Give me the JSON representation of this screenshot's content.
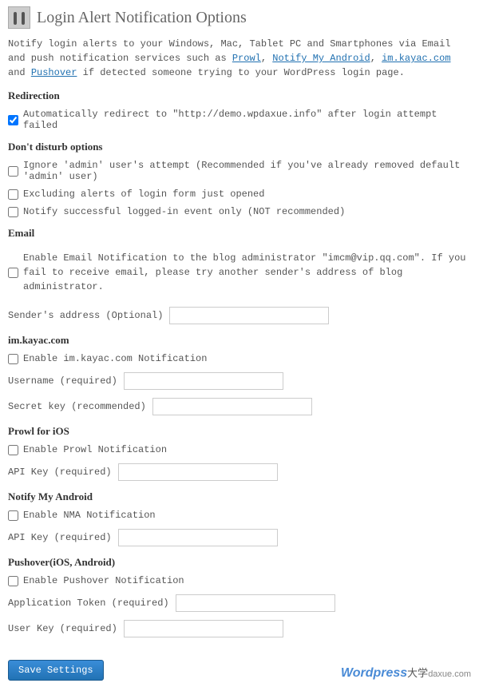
{
  "page": {
    "title": "Login Alert Notification Options",
    "intro_pre": "Notify login alerts to your Windows, Mac, Tablet PC and Smartphones via Email and push notification services such as ",
    "link_prowl": "Prowl",
    "sep1": ", ",
    "link_nma": "Notify My Android",
    "sep2": ", ",
    "link_kayac": "im.kayac.com",
    "sep3": " and ",
    "link_pushover": "Pushover",
    "intro_post": " if detected someone trying to your WordPress login page."
  },
  "redirection": {
    "heading": "Redirection",
    "auto_redirect_label": "Automatically redirect to \"http://demo.wpdaxue.info\" after login attempt failed"
  },
  "dnd": {
    "heading": "Don't disturb options",
    "ignore_admin_label": "Ignore 'admin' user's attempt (Recommended if you've already removed default 'admin' user)",
    "excluding_label": "Excluding alerts of login form just opened",
    "success_only_label": "Notify successful logged-in event only (NOT recommended)"
  },
  "email": {
    "heading": "Email",
    "enable_pre": "Enable Email Notification to the blog administrator \"imcm@vip.qq.com\". If you fail to receive email, please try another sender's address of blog administrator.",
    "sender_label": "Sender's address (Optional)"
  },
  "kayac": {
    "heading": "im.kayac.com",
    "enable_label": "Enable im.kayac.com Notification",
    "username_label": "Username (required)",
    "secret_label": "Secret key (recommended)"
  },
  "prowl": {
    "heading": "Prowl for iOS",
    "enable_label": "Enable Prowl Notification",
    "apikey_label": "API Key (required)"
  },
  "nma": {
    "heading": "Notify My Android",
    "enable_label": "Enable NMA Notification",
    "apikey_label": "API Key (required)"
  },
  "pushover": {
    "heading": "Pushover(iOS, Android)",
    "enable_label": "Enable Pushover Notification",
    "apptoken_label": "Application Token (required)",
    "userkey_label": "User Key (required)"
  },
  "actions": {
    "save_label": "Save Settings"
  },
  "watermark": {
    "wp": "Wordpress",
    "cn": "大学",
    "domain": "daxue.com"
  }
}
